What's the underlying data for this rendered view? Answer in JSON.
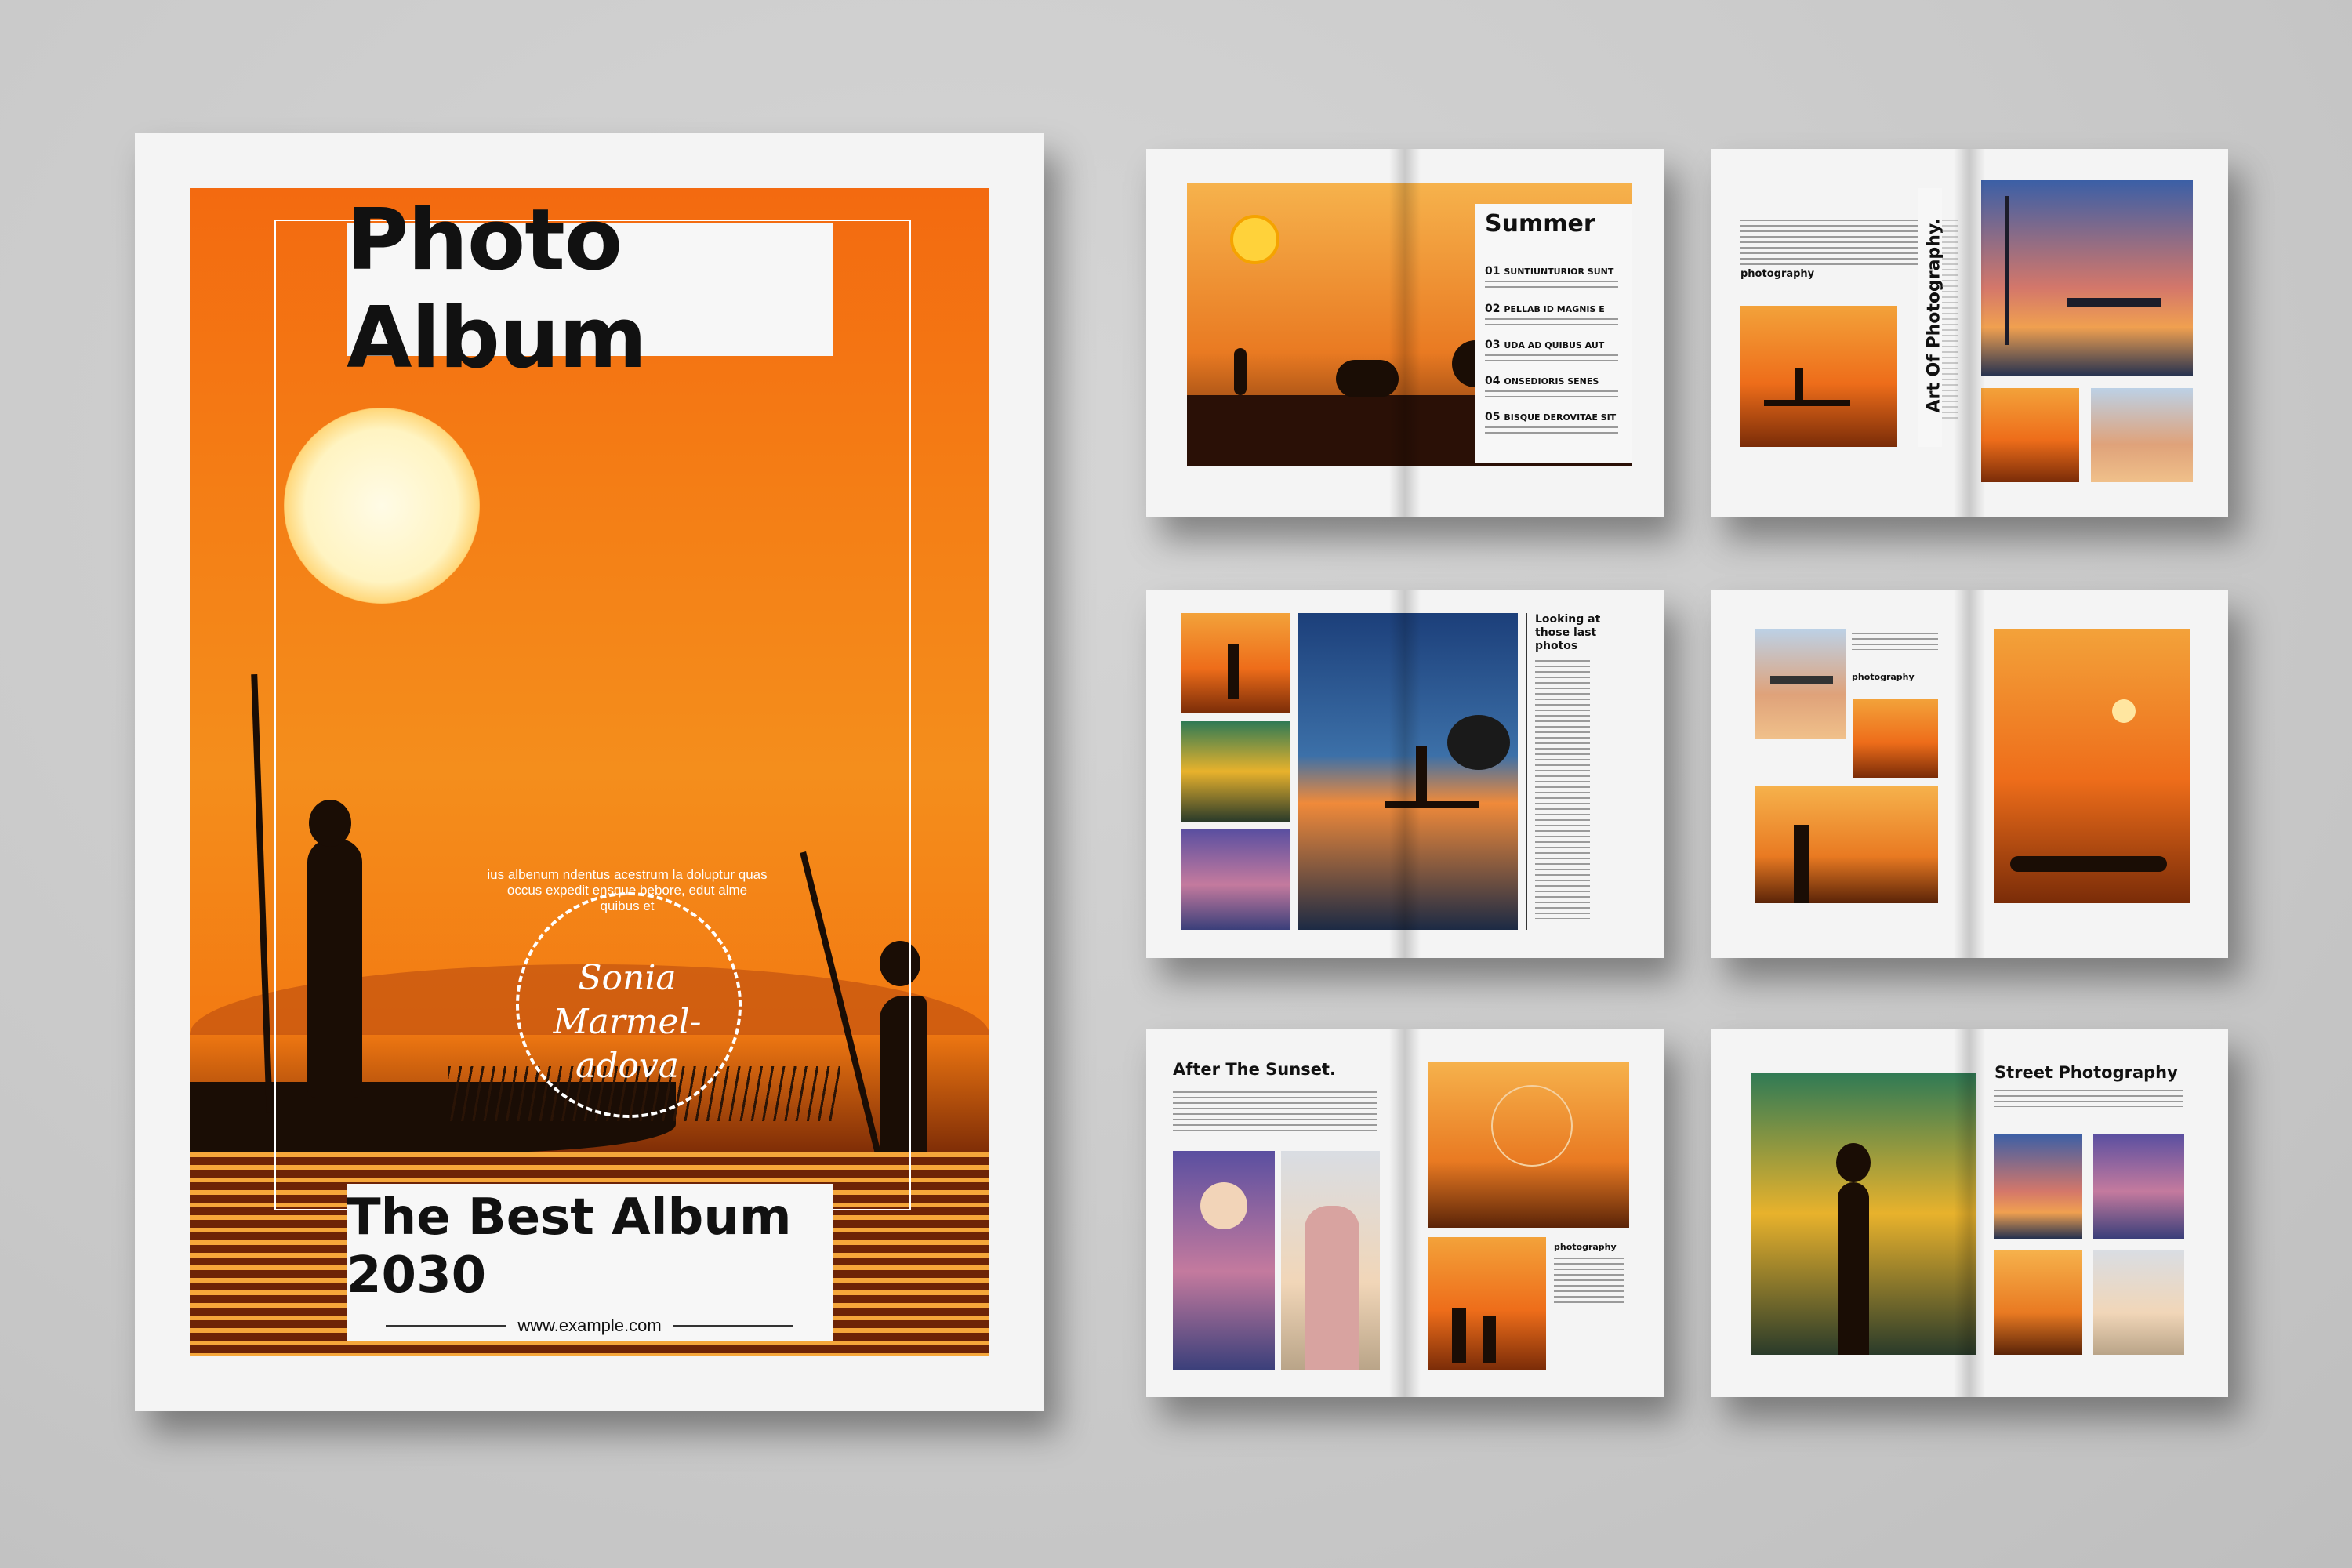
{
  "cover": {
    "title": "Photo Album",
    "subtitle": "The Best Album 2030",
    "url": "www.example.com",
    "author_line1": "Sonia",
    "author_line2": "Marmel-",
    "author_line3": "adova",
    "circular_text": "ius albenum ndentus acestrum la doluptur quas occus expedit ensque bebore, edut alme quibus et"
  },
  "spread_summer": {
    "title": "Summer",
    "items": [
      {
        "num": "01",
        "label": "SUNTIUNTURIOR SUNT"
      },
      {
        "num": "02",
        "label": "PELLAB ID MAGNIS E"
      },
      {
        "num": "03",
        "label": "UDA AD QUIBUS AUT"
      },
      {
        "num": "04",
        "label": "ONSEDIORIS SENES"
      },
      {
        "num": "05",
        "label": "BISQUE DEROVITAE SIT"
      }
    ]
  },
  "spread_art": {
    "title": "Art Of Photography.",
    "caption": "photography"
  },
  "spread_looking": {
    "title_l1": "Looking at",
    "title_l2": "those last",
    "title_l3": "photos"
  },
  "spread_birds": {
    "caption": "photography"
  },
  "spread_after": {
    "title": "After The Sunset.",
    "caption": "photography"
  },
  "spread_street": {
    "title": "Street Photography"
  },
  "colors": {
    "background": "#c9c9c9",
    "accent_orange": "#f47d15",
    "paper": "#f4f4f4",
    "ink": "#111111"
  }
}
